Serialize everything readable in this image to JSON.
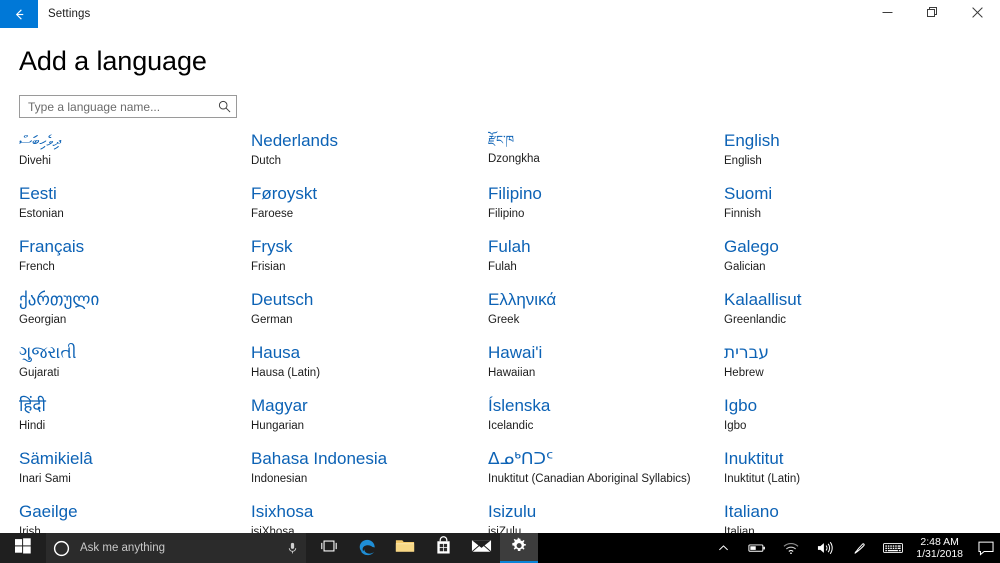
{
  "window": {
    "titlebar_title": "Settings",
    "back_label": "Back",
    "minimize_label": "Minimize",
    "restore_label": "Restore",
    "close_label": "Close",
    "accent_color": "#0078d7"
  },
  "page": {
    "title": "Add a language",
    "link_color": "#0c62b5"
  },
  "search": {
    "placeholder": "Type a language name...",
    "value": ""
  },
  "languages": {
    "columns": [
      [
        {
          "native": "ދިވެހިބަސް",
          "english": "Divehi",
          "script": "script-thaana"
        },
        {
          "native": "Eesti",
          "english": "Estonian",
          "script": ""
        },
        {
          "native": "Français",
          "english": "French",
          "script": ""
        },
        {
          "native": "ქართული",
          "english": "Georgian",
          "script": "script-indic"
        },
        {
          "native": "ગુજરાતી",
          "english": "Gujarati",
          "script": "script-indic"
        },
        {
          "native": "हिंदी",
          "english": "Hindi",
          "script": "script-indic"
        },
        {
          "native": "Sämikielâ",
          "english": "Inari Sami",
          "script": ""
        },
        {
          "native": "Gaeilge",
          "english": "Irish",
          "script": ""
        }
      ],
      [
        {
          "native": "Nederlands",
          "english": "Dutch",
          "script": ""
        },
        {
          "native": "Føroyskt",
          "english": "Faroese",
          "script": ""
        },
        {
          "native": "Frysk",
          "english": "Frisian",
          "script": ""
        },
        {
          "native": "Deutsch",
          "english": "German",
          "script": ""
        },
        {
          "native": "Hausa",
          "english": "Hausa (Latin)",
          "script": ""
        },
        {
          "native": "Magyar",
          "english": "Hungarian",
          "script": ""
        },
        {
          "native": "Bahasa Indonesia",
          "english": "Indonesian",
          "script": ""
        },
        {
          "native": "Isixhosa",
          "english": "isiXhosa",
          "script": ""
        }
      ],
      [
        {
          "native": "རྫོང་ཁ",
          "english": "Dzongkha",
          "script": "script-tibetan"
        },
        {
          "native": "Filipino",
          "english": "Filipino",
          "script": ""
        },
        {
          "native": "Fulah",
          "english": "Fulah",
          "script": ""
        },
        {
          "native": "Ελληνικά",
          "english": "Greek",
          "script": ""
        },
        {
          "native": "Hawai'i",
          "english": "Hawaiian",
          "script": ""
        },
        {
          "native": "Íslenska",
          "english": "Icelandic",
          "script": ""
        },
        {
          "native": "ᐃᓄᒃᑎᑐᑦ",
          "english": "Inuktitut (Canadian Aboriginal Syllabics)",
          "script": "script-syllabics"
        },
        {
          "native": "Isizulu",
          "english": "isiZulu",
          "script": ""
        }
      ],
      [
        {
          "native": "English",
          "english": "English",
          "script": ""
        },
        {
          "native": "Suomi",
          "english": "Finnish",
          "script": ""
        },
        {
          "native": "Galego",
          "english": "Galician",
          "script": ""
        },
        {
          "native": "Kalaallisut",
          "english": "Greenlandic",
          "script": ""
        },
        {
          "native": "עברית",
          "english": "Hebrew",
          "script": "script-indic"
        },
        {
          "native": "Igbo",
          "english": "Igbo",
          "script": ""
        },
        {
          "native": "Inuktitut",
          "english": "Inuktitut (Latin)",
          "script": ""
        },
        {
          "native": "Italiano",
          "english": "Italian",
          "script": ""
        }
      ]
    ]
  },
  "taskbar": {
    "start_label": "Start",
    "cortana_placeholder": "Ask me anything",
    "mic_label": "Microphone",
    "apps": [
      {
        "name": "task-view",
        "label": "Task View"
      },
      {
        "name": "edge",
        "label": "Microsoft Edge"
      },
      {
        "name": "file-explorer",
        "label": "File Explorer"
      },
      {
        "name": "store",
        "label": "Microsoft Store"
      },
      {
        "name": "mail",
        "label": "Mail"
      },
      {
        "name": "settings",
        "label": "Settings"
      }
    ],
    "tray": [
      {
        "name": "show-hidden-icons",
        "label": "Show hidden icons"
      },
      {
        "name": "battery",
        "label": "Battery"
      },
      {
        "name": "network",
        "label": "Network"
      },
      {
        "name": "volume",
        "label": "Volume"
      },
      {
        "name": "pen",
        "label": "Windows Ink Workspace"
      },
      {
        "name": "keyboard",
        "label": "Touch keyboard"
      }
    ],
    "clock": {
      "time": "2:48 AM",
      "date": "1/31/2018"
    },
    "action_center_label": "Action Center"
  }
}
